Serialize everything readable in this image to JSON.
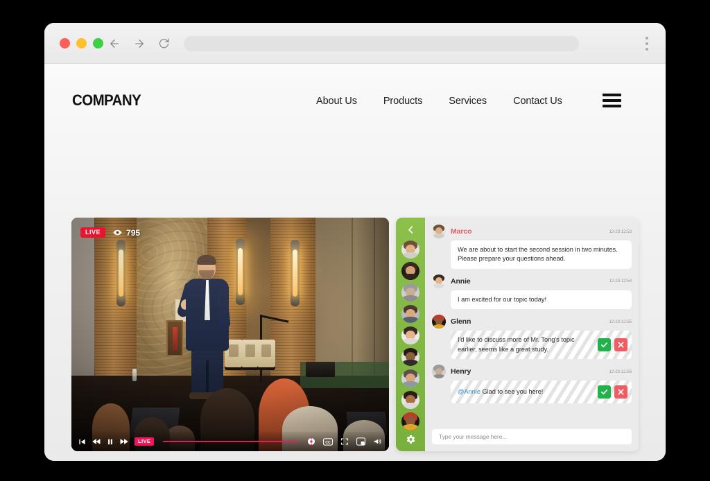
{
  "browser": {
    "traffic_lights": [
      "close",
      "minimize",
      "maximize"
    ],
    "back_label": "Back",
    "forward_label": "Forward",
    "reload_label": "Reload",
    "url_value": "",
    "url_placeholder": "",
    "menu_label": "Browser menu"
  },
  "site": {
    "brand": "COMPANY",
    "nav": [
      {
        "label": "About Us"
      },
      {
        "label": "Products"
      },
      {
        "label": "Services"
      },
      {
        "label": "Contact Us"
      }
    ],
    "hamburger_label": "Menu"
  },
  "video": {
    "live_badge": "LIVE",
    "viewer_count": "795",
    "eye_icon": "eye-icon",
    "controls": {
      "skip_back": "skip-back-icon",
      "rewind": "rewind-icon",
      "pause": "pause-icon",
      "fast_forward": "fast-forward-icon",
      "live_chip": "LIVE",
      "progress_percent": 100,
      "settings": "video-settings-icon",
      "captions": "closed-captions-icon",
      "fullscreen": "fullscreen-icon",
      "picture_in_picture": "picture-in-picture-icon",
      "volume": "volume-icon"
    },
    "accent_color": "#f5145c"
  },
  "chat": {
    "sidebar": {
      "back_icon": "chevron-left-icon",
      "settings_icon": "gear-icon",
      "avatar_count": 9,
      "background_color": "#84b944"
    },
    "messages": [
      {
        "name": "Marco",
        "name_accent": true,
        "time": "12-23 12:53",
        "text": "We are about to start the second session in two minutes. Please prepare your questions ahead.",
        "pending": false,
        "mention": ""
      },
      {
        "name": "Annie",
        "name_accent": false,
        "time": "12-23 12:54",
        "text": "I am excited for our topic today!",
        "pending": false,
        "mention": ""
      },
      {
        "name": "Glenn",
        "name_accent": false,
        "time": "12-23 12:55",
        "text": "I'd like to discuss more of Mr. Tong's topic earlier, seems like a great study.",
        "pending": true,
        "mention": ""
      },
      {
        "name": "Henry",
        "name_accent": false,
        "time": "12-23 12:56",
        "text": "Glad to see you here!",
        "pending": true,
        "mention": "@Annie"
      }
    ],
    "moderation": {
      "approve_label": "Approve",
      "reject_label": "Reject",
      "approve_color": "#22b24c",
      "reject_color": "#ef5d62"
    },
    "input_placeholder": "Type your message here...",
    "input_value": "",
    "accent_name_color": "#e05f6a",
    "mention_color": "#3b8fd4"
  }
}
